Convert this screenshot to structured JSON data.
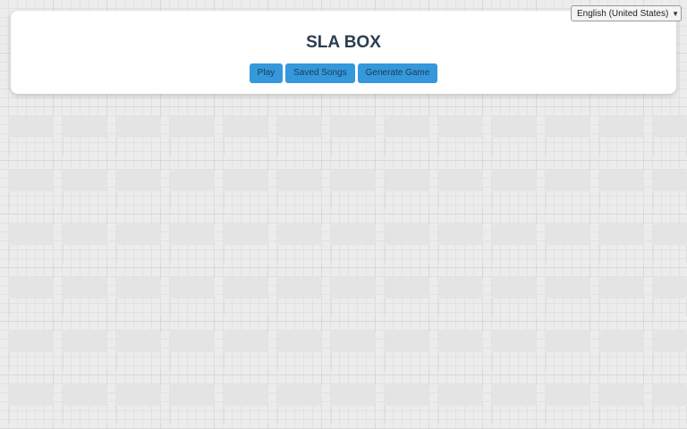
{
  "header": {
    "title": "SLA BOX"
  },
  "actions": {
    "play_label": "Play",
    "saved_songs_label": "Saved Songs",
    "generate_game_label": "Generate Game"
  },
  "language": {
    "selected": "English (United States)"
  },
  "colors": {
    "accent": "#3498db",
    "title": "#2c3e50",
    "background": "#ececec",
    "card": "#ffffff"
  },
  "icons": {
    "language_dropdown": "chevron-down-icon"
  }
}
